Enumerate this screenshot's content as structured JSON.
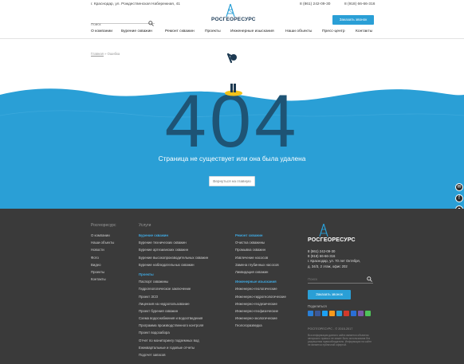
{
  "header": {
    "address": "г. Краснодар, ул. Рождественская Набережная, 41",
    "phone1": "8 (861) 242-09-30",
    "phone2": "8 (918) 66-66-316",
    "search_placeholder": "Поиск",
    "logo_text": "РОСГЕОРЕСУРС",
    "order_button": "Заказать звонок"
  },
  "nav": {
    "items": [
      "О компании",
      "Бурение скважин",
      "Ремонт скважин",
      "Проекты",
      "Инженерные изыскания",
      "Наши объекты",
      "Пресс-центр",
      "Контакты"
    ]
  },
  "breadcrumb": {
    "home": "Главная",
    "sep": "»",
    "current": "Ошибка"
  },
  "error": {
    "code": "404",
    "message": "Страница не существует или она была удалена",
    "back_button": "Вернуться на главную"
  },
  "colors": {
    "sea": "#2a9fd6",
    "digits": "#1e5475",
    "footer": "#3a3a3a",
    "accent": "#3fa8e0",
    "buoy": "#f2c21a"
  },
  "footer": {
    "col1_heading": "Росгеоресурс",
    "col1_items": [
      "О компании",
      "Наши объекты",
      "Новости",
      "Фото",
      "Видео",
      "Проекты",
      "Контакты"
    ],
    "col2_heading": "Услуги",
    "drilling_title": "Бурение скважин",
    "drilling_items": [
      "Бурение технических скважин",
      "Бурение артезианских скважин",
      "Бурение высокопроизводительных скважин",
      "Бурение наблюдательных скважин"
    ],
    "projects_title": "Проекты",
    "projects_items": [
      "Паспорт скважины",
      "Гидрогеологическое заключение",
      "Проект ЗСО",
      "Лицензия на недропользование",
      "Проект бурения скважин",
      "Схема водоснабжения и водоотведения",
      "Программа производственного контроля",
      "Проект водозабора",
      "Отчет по мониторингу подземных вод",
      "Ежеквартальные и годовые отчеты",
      "Подсчет запасов"
    ],
    "repair_title": "Ремонт скважин",
    "repair_items": [
      "Очистка скважины",
      "Промывка скважин",
      "Извлечение насосов",
      "Замена глубинных насосов",
      "Ликвидация скважин"
    ],
    "survey_title": "Инженерные изыскания",
    "survey_items": [
      "Инженерно-геологические",
      "Инженерно-гидрогеологические",
      "Инженерно-геодезические",
      "Инженерно-геофизические",
      "Инженерно-экологические",
      "Геологоразведка"
    ],
    "logo_text": "РОСГЕОРЕСУРС",
    "phone1": "8 (861) 242-09-30",
    "phone2": "8 (918) 66-66-316",
    "address1": "г. Краснодар, ул. 70 лет Октября,",
    "address2": "д. 34/3, 2 этаж, офис 202",
    "search_placeholder": "Поиск",
    "order_button": "Заказать звонок",
    "share_label": "Поделиться",
    "copyright": "РОСГЕОРЕСУРС - © 2015-2017",
    "disclaimer": "Вся информация данного сайта является объектом авторского права и не может быть использована без разрешения правообладателя. Информация на сайте не является публичной офертой."
  },
  "side_buttons": [
    "vk-icon",
    "facebook-icon",
    "mail-icon"
  ]
}
